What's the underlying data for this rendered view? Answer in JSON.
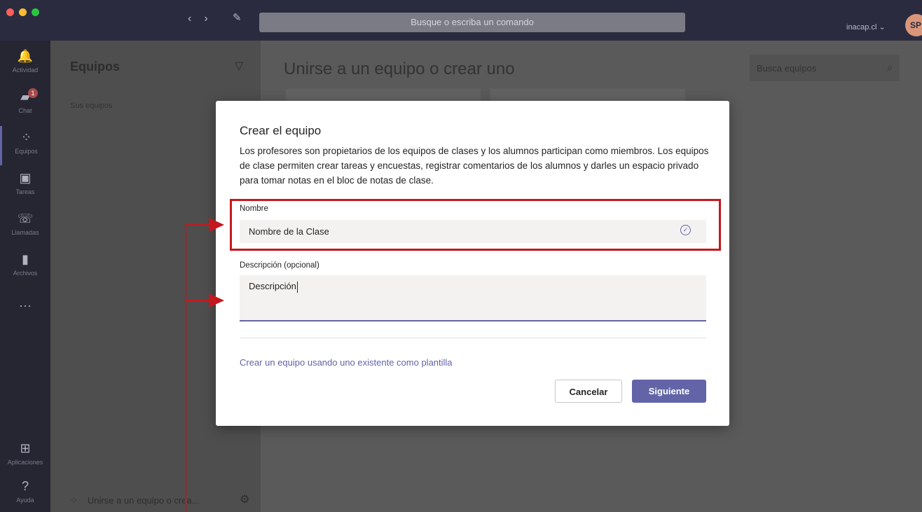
{
  "titlebar": {
    "back_glyph": "‹",
    "forward_glyph": "›",
    "compose_glyph": "✎",
    "command_placeholder": "Busque o escriba un comando",
    "tenant": "inacap.cl ⌄",
    "avatar_initials": "SP"
  },
  "rail": {
    "items": [
      {
        "label": "Actividad",
        "icon": "bell-icon",
        "glyph": "🔔"
      },
      {
        "label": "Chat",
        "icon": "chat-icon",
        "glyph": "▰",
        "badge": "1"
      },
      {
        "label": "Equipos",
        "icon": "teams-icon",
        "glyph": "⁘"
      },
      {
        "label": "Tareas",
        "icon": "assignments-icon",
        "glyph": "▣"
      },
      {
        "label": "Llamadas",
        "icon": "phone-icon",
        "glyph": "☏"
      },
      {
        "label": "Archivos",
        "icon": "files-icon",
        "glyph": "▮"
      },
      {
        "label": "",
        "icon": "more-icon",
        "glyph": "···"
      },
      {
        "label": "Aplicaciones",
        "icon": "apps-icon",
        "glyph": "⊞"
      },
      {
        "label": "Ayuda",
        "icon": "help-icon",
        "glyph": "?"
      }
    ]
  },
  "panel": {
    "title": "Equipos",
    "filter_glyph": "▽",
    "section": "Sus equipos",
    "footer_icon_glyph": "⁘",
    "footer": "Unirse a un equipo o crea...",
    "gear_glyph": "⚙"
  },
  "main": {
    "title": "Unirse a un equipo o crear uno",
    "search_placeholder": "Busca equipos",
    "search_glyph": "⌕"
  },
  "modal": {
    "title": "Crear el equipo",
    "description": "Los profesores son propietarios de los equipos de clases y los alumnos participan como miembros. Los equipos de clase permiten crear tareas y encuestas, registrar comentarios de los alumnos y darles un espacio privado para tomar notas en el bloc de notas de clase.",
    "name_label": "Nombre",
    "name_value": "Nombre de la Clase",
    "name_check_glyph": "✓",
    "desc_label": "Descripción (opcional)",
    "desc_value": "Descripción",
    "template_link": "Crear un equipo usando uno existente como plantilla",
    "cancel_label": "Cancelar",
    "next_label": "Siguiente"
  },
  "colors": {
    "accent": "#6264a7",
    "annotation": "#c4181f"
  }
}
